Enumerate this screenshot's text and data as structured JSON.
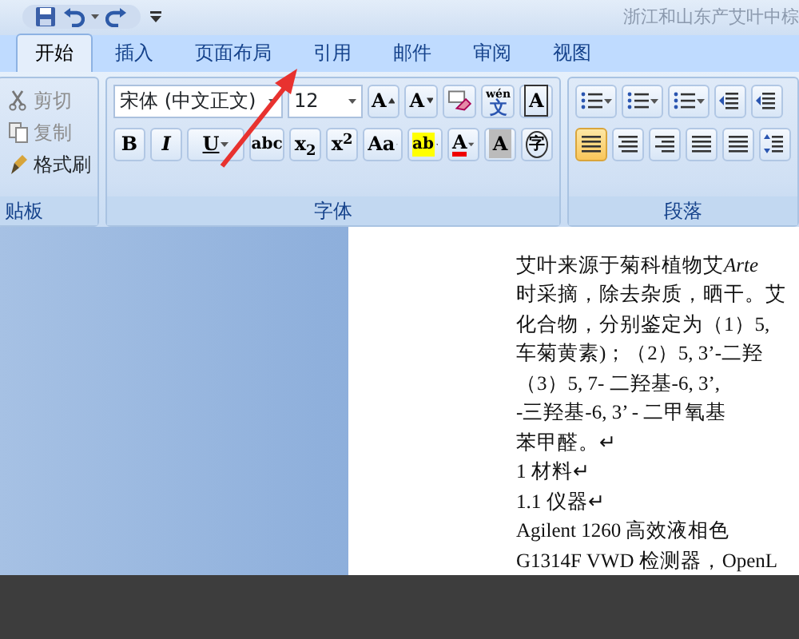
{
  "window": {
    "title": "浙江和山东产艾叶中棕"
  },
  "tabs": [
    {
      "label": "开始",
      "selected": true
    },
    {
      "label": "插入",
      "selected": false
    },
    {
      "label": "页面布局",
      "selected": false
    },
    {
      "label": "引用",
      "selected": false
    },
    {
      "label": "邮件",
      "selected": false
    },
    {
      "label": "审阅",
      "selected": false
    },
    {
      "label": "视图",
      "selected": false
    }
  ],
  "clipboard": {
    "label": "贴板",
    "items": [
      {
        "kind": "cut",
        "label": "剪切",
        "disabled": true
      },
      {
        "kind": "copy",
        "label": "复制",
        "disabled": true
      },
      {
        "kind": "painter",
        "label": "格式刷",
        "disabled": false
      }
    ]
  },
  "font": {
    "label": "字体",
    "font_name": "宋体 (中文正文)",
    "font_size": "12",
    "row1": [
      {
        "kind": "grow",
        "label": "A"
      },
      {
        "kind": "shrink",
        "label": "A"
      },
      {
        "kind": "clear"
      },
      {
        "kind": "phonetic",
        "label": "wén",
        "sub": "文"
      },
      {
        "kind": "boxed",
        "label": "A"
      }
    ],
    "row2": [
      {
        "kind": "text",
        "label": "B"
      },
      {
        "kind": "text",
        "label": "I"
      },
      {
        "kind": "drop",
        "label": "U"
      },
      {
        "kind": "strike",
        "label": "abc"
      },
      {
        "kind": "text",
        "label": "x$_{2}$"
      },
      {
        "kind": "text",
        "label": "x$^{2}$"
      },
      {
        "kind": "drop",
        "label": "Aa"
      },
      {
        "kind": "highlight",
        "label": "ab"
      },
      {
        "kind": "fontcolor",
        "label": "A"
      },
      {
        "kind": "shade",
        "label": "A"
      },
      {
        "kind": "circled",
        "label": "字"
      }
    ]
  },
  "paragraph": {
    "label": "段落",
    "align": [
      {
        "kind": "left",
        "selected": true
      },
      {
        "kind": "center",
        "selected": false
      },
      {
        "kind": "right",
        "selected": false
      },
      {
        "kind": "justify",
        "selected": false
      },
      {
        "kind": "distributed",
        "selected": false
      }
    ]
  },
  "document": {
    "first_line": {
      "text": "艾叶来源于菊科植物艾",
      "italic": "Arte"
    },
    "lines": [
      "时采摘，除去杂质，晒干。艾",
      "化合物，分别鉴定为（1）5,",
      "车菊黄素)；（2）5, 3’-二羟",
      "（3）5, 7- 二羟基-6, 3’,",
      "-三羟基-6, 3’ - 二甲氧基",
      "苯甲醛。↵",
      "1  材料↵",
      "1.1 仪器↵",
      "Agilent  1260 高效液相色",
      "G1314F  VWD 检测器，OpenL"
    ]
  }
}
